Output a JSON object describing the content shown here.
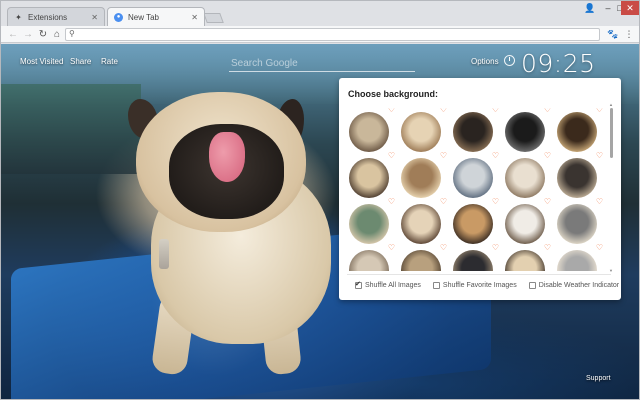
{
  "browser": {
    "tabs": [
      {
        "title": "Extensions",
        "icon": "puzzle-icon",
        "active": false
      },
      {
        "title": "New Tab",
        "icon": "search-icon",
        "active": true
      }
    ],
    "omnibox_value": ""
  },
  "page": {
    "nav": {
      "most_visited": "Most Visited",
      "share": "Share",
      "rate": "Rate",
      "options": "Options"
    },
    "search_placeholder": "Search Google",
    "clock": "09:25",
    "support": "Support"
  },
  "panel": {
    "title": "Choose background:",
    "options": [
      {
        "label": "Shuffle All Images",
        "checked": true
      },
      {
        "label": "Shuffle Favorite Images",
        "checked": false
      },
      {
        "label": "Disable Weather Indicator",
        "checked": false
      }
    ],
    "heart_glyph": "♡",
    "thumb_count": 20
  }
}
